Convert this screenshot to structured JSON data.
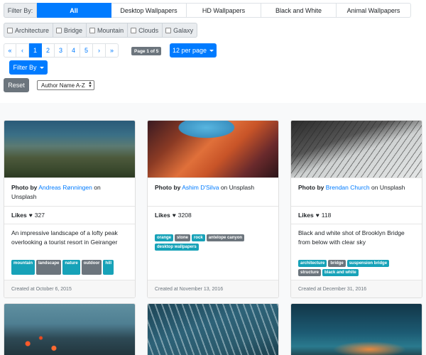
{
  "filter_bar": {
    "label": "Filter By:",
    "categories": [
      {
        "label": "All",
        "active": true
      },
      {
        "label": "Desktop Wallpapers",
        "active": false
      },
      {
        "label": "HD Wallpapers",
        "active": false
      },
      {
        "label": "Black and White",
        "active": false
      },
      {
        "label": "Animal Wallpapers",
        "active": false
      }
    ]
  },
  "tag_filters": [
    "Architecture",
    "Bridge",
    "Mountain",
    "Clouds",
    "Galaxy"
  ],
  "pagination": {
    "first": "«",
    "prev": "‹",
    "pages": [
      "1",
      "2",
      "3",
      "4",
      "5"
    ],
    "next": "›",
    "last": "»",
    "current_page": "1",
    "page_badge": "Page 1 of 5",
    "per_page": "12 per page"
  },
  "filter_by_button": "Filter By",
  "reset_button": "Reset",
  "sort_select": "Author Name A-Z",
  "labels": {
    "photo_by": "Photo by",
    "on": "on",
    "on_unsplash": "Unsplash",
    "likes": "Likes",
    "heart": "♥"
  },
  "cards": [
    {
      "author": "Andreas Rønningen",
      "likes": "327",
      "description": "An impressive landscape of a lofty peak overlooking a tourist resort in Geiranger",
      "tags": [
        "mountain",
        "landscape",
        "nature",
        "outdoor",
        "hill"
      ],
      "created": "Created at October 6, 2015",
      "image": "mountain-landscape"
    },
    {
      "author": "Ashim D'Silva",
      "likes": "3208",
      "description": "",
      "tags": [
        "orange",
        "stone",
        "rock",
        "antelope canyon",
        "desktop wallpapers"
      ],
      "created": "Created at November 13, 2016",
      "image": "antelope-canyon"
    },
    {
      "author": "Brendan Church",
      "likes": "118",
      "description": "Black and white shot of Brooklyn Bridge from below with clear sky",
      "tags": [
        "architecture",
        "bridge",
        "suspension bridge",
        "structure",
        "black and white"
      ],
      "created": "Created at December 31, 2016",
      "image": "brooklyn-bridge"
    }
  ],
  "bottom_images": [
    "lava-ocean",
    "ocean-waves",
    "night-sky"
  ],
  "colors": {
    "primary": "#007bff",
    "secondary": "#6c757d",
    "info": "#17a2b8"
  }
}
